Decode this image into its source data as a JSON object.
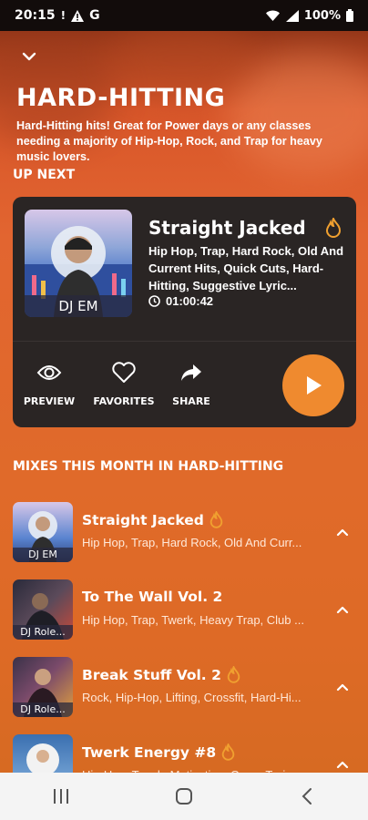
{
  "status_bar": {
    "time": "20:15",
    "indicator_1": "!",
    "indicator_2": "G",
    "battery": "100%"
  },
  "header": {
    "title": "HARD-HITTING",
    "description": "Hard-Hitting hits! Great for Power days or any classes needing a majority of Hip-Hop, Rock, and Trap for heavy music lovers."
  },
  "up_next": {
    "section_label": "UP NEXT",
    "title": "Straight Jacked",
    "art_caption": "DJ EM",
    "tags": "Hip Hop, Trap, Hard Rock, Old And Current Hits, Quick Cuts, Hard-Hitting, Suggestive Lyric...",
    "duration": "01:00:42",
    "actions": {
      "preview": "PREVIEW",
      "favorites": "FAVORITES",
      "share": "SHARE"
    },
    "hot": true
  },
  "mixes": {
    "section_label": "MIXES THIS MONTH IN HARD-HITTING",
    "items": [
      {
        "title": "Straight Jacked",
        "subtitle": "Hip Hop, Trap, Hard Rock, Old And Curr...",
        "art_caption": "DJ EM",
        "hot": true
      },
      {
        "title": "To The Wall Vol. 2",
        "subtitle": "Hip Hop, Trap, Twerk, Heavy Trap, Club ...",
        "art_caption": "DJ Role...",
        "hot": false
      },
      {
        "title": "Break Stuff Vol. 2",
        "subtitle": "Rock, Hip-Hop, Lifting, Crossfit, Hard-Hi...",
        "art_caption": "DJ Role...",
        "hot": true
      },
      {
        "title": "Twerk Energy #8",
        "subtitle": "Hip-Hop, Twerk, Motivation, Cross-Train...",
        "art_caption": "",
        "hot": true
      }
    ]
  },
  "colors": {
    "accent": "#ef8a2f",
    "card_bg": "#2a2524",
    "fire": "#f0a030"
  }
}
